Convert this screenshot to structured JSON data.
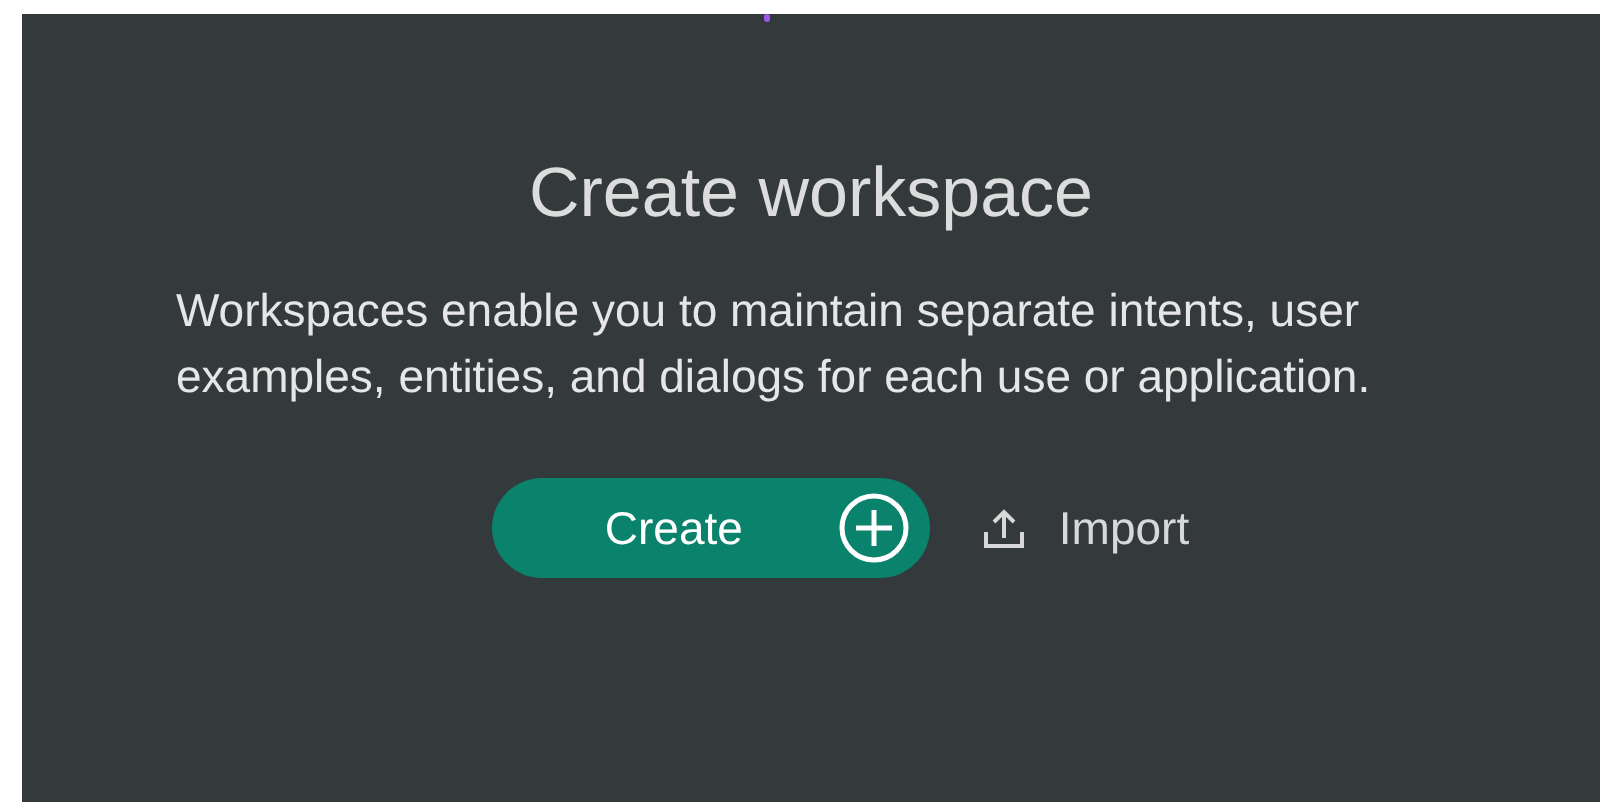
{
  "dialog": {
    "title": "Create workspace",
    "description": "Workspaces enable you to maintain separate intents, user examples, entities, and dialogs for each use or application.",
    "buttons": [
      {
        "kind": "primary",
        "label": "Create"
      },
      {
        "kind": "secondary",
        "label": "Import"
      }
    ]
  }
}
